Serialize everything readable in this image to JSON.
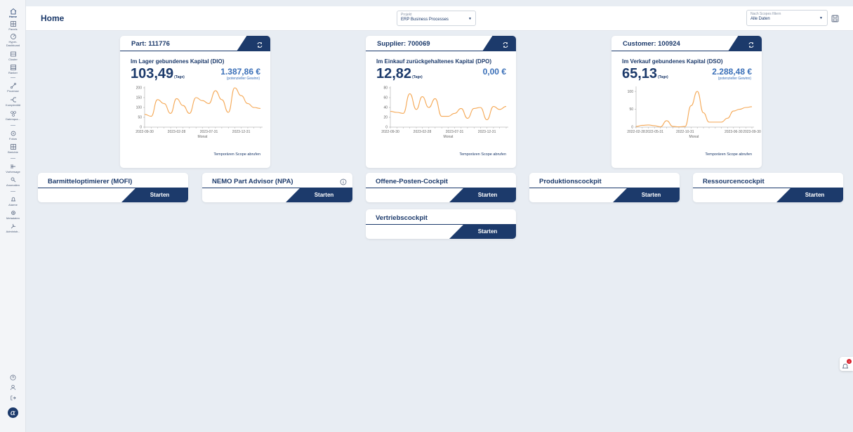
{
  "sidebar": {
    "items": [
      {
        "label": "Home",
        "icon": "home-icon"
      },
      {
        "label": "Panels",
        "icon": "panels-icon"
      },
      {
        "label": "Hyper-",
        "label2": "Dashboard",
        "icon": "hyper-dashboard-icon"
      },
      {
        "label": "Cluster",
        "icon": "cluster-icon"
      },
      {
        "label": "Ranker",
        "icon": "ranker-icon"
      },
      {
        "label": "Prozesse",
        "icon": "prozesse-icon"
      },
      {
        "label": "Komplexität",
        "icon": "komplexitaet-icon"
      },
      {
        "label": "Datenqua...",
        "icon": "datenqualitaet-icon"
      },
      {
        "label": "Fokus",
        "icon": "fokus-icon"
      },
      {
        "label": "Berichte",
        "icon": "berichte-icon"
      },
      {
        "label": "Vorhersage",
        "icon": "vorhersage-icon"
      },
      {
        "label": "Anomalien",
        "icon": "anomalien-icon"
      },
      {
        "label": "Alarme",
        "icon": "alarme-icon"
      },
      {
        "label": "Metadaten",
        "icon": "metadaten-icon"
      },
      {
        "label": "Administr...",
        "icon": "administration-icon"
      }
    ],
    "bottom": [
      "help-icon",
      "user-icon",
      "logout-icon"
    ],
    "logo": "α"
  },
  "header": {
    "title": "Home",
    "project": {
      "label": "Projekt",
      "value": "ERP Business Processes"
    },
    "scope": {
      "label": "Nach Scopes filtern",
      "value": "Alle Daten"
    }
  },
  "kpis": [
    {
      "title": "Part: 111776",
      "subtitle": "Im Lager gebundenes Kapital (DIO)",
      "value": "103,49",
      "unit": "(Tage)",
      "amount": "1.387,86 €",
      "amount_hint": "(potenzieller Gewinn)",
      "link": "Temporären Scope abrufen",
      "color": "#f5a855",
      "chart_data": {
        "type": "line",
        "xlabel": "Monat",
        "x_ticks": [
          "2022-09-30",
          "2023-02-28",
          "2023-07-31",
          "2023-12-31"
        ],
        "y_ticks": [
          0,
          50,
          100,
          150,
          200
        ],
        "ylim": [
          0,
          200
        ],
        "x": [
          "2022-09-30",
          "2022-10-31",
          "2022-11-30",
          "2022-12-31",
          "2023-01-31",
          "2023-02-28",
          "2023-03-31",
          "2023-04-30",
          "2023-05-31",
          "2023-06-30",
          "2023-07-31",
          "2023-08-31",
          "2023-09-30",
          "2023-10-31",
          "2023-11-30",
          "2023-12-31",
          "2024-01-31",
          "2024-02-29",
          "2024-03-31"
        ],
        "values": [
          65,
          55,
          140,
          120,
          70,
          145,
          110,
          70,
          150,
          135,
          120,
          185,
          140,
          75,
          200,
          160,
          120,
          100,
          95
        ]
      }
    },
    {
      "title": "Supplier: 700069",
      "subtitle": "Im Einkauf zurückgehaltenes Kapital (DPO)",
      "value": "12,82",
      "unit": "(Tage)",
      "amount": "0,00 €",
      "amount_hint": "",
      "link": "Temporären Scope abrufen",
      "color": "#f5a855",
      "chart_data": {
        "type": "line",
        "xlabel": "Monat",
        "x_ticks": [
          "2022-09-30",
          "2023-02-28",
          "2023-07-31",
          "2023-12-31"
        ],
        "y_ticks": [
          0,
          20,
          40,
          60,
          80
        ],
        "ylim": [
          0,
          80
        ],
        "x": [
          "2022-09-30",
          "2022-10-31",
          "2022-11-30",
          "2022-12-31",
          "2023-01-31",
          "2023-02-28",
          "2023-03-31",
          "2023-04-30",
          "2023-05-31",
          "2023-06-30",
          "2023-07-31",
          "2023-08-31",
          "2023-09-30",
          "2023-10-31",
          "2023-11-30",
          "2023-12-31",
          "2024-01-31",
          "2024-02-29",
          "2024-03-31"
        ],
        "values": [
          32,
          30,
          28,
          68,
          36,
          62,
          40,
          58,
          22,
          22,
          28,
          38,
          18,
          38,
          40,
          15,
          42,
          36,
          42
        ]
      }
    },
    {
      "title": "Customer: 100924",
      "subtitle": "Im Verkauf gebundenes Kapital (DSO)",
      "value": "65,13",
      "unit": "(Tage)",
      "amount": "2.288,48 €",
      "amount_hint": "(potenzieller Gewinn)",
      "link": "Temporären Scope abrufen",
      "color": "#f5a855",
      "chart_data": {
        "type": "line",
        "xlabel": "Monat",
        "x_ticks": [
          "2022-02-28",
          "2022-05-31",
          "2022-10-31",
          "2023-06-30",
          "2023-09-30"
        ],
        "y_ticks": [
          0,
          50,
          100
        ],
        "ylim": [
          0,
          110
        ],
        "x": [
          "2022-02-28",
          "2022-03-31",
          "2022-04-30",
          "2022-05-31",
          "2022-06-30",
          "2022-07-31",
          "2022-08-31",
          "2022-09-30",
          "2022-10-31",
          "2022-11-30",
          "2022-12-31",
          "2023-01-31",
          "2023-02-28",
          "2023-03-31",
          "2023-04-30",
          "2023-05-31",
          "2023-06-30",
          "2023-07-31",
          "2023-08-31",
          "2023-09-30"
        ],
        "values": [
          2,
          5,
          6,
          4,
          1,
          18,
          2,
          1,
          2,
          60,
          100,
          40,
          14,
          14,
          14,
          25,
          45,
          50,
          55,
          57
        ]
      }
    }
  ],
  "launchers": [
    {
      "title": "Barmitteloptimierer (MOFI)",
      "button": "Starten"
    },
    {
      "title": "NEMO Part Advisor (NPA)",
      "button": "Starten"
    },
    {
      "title": "Offene-Posten-Cockpit",
      "button": "Starten"
    },
    {
      "title": "Produktionscockpit",
      "button": "Starten"
    },
    {
      "title": "Ressourcencockpit",
      "button": "Starten"
    },
    {
      "title": "Vertriebscockpit",
      "button": "Starten"
    }
  ],
  "notifications": {
    "count": "1"
  },
  "colors": {
    "brand": "#1c3a6b",
    "accent": "#3b70b8",
    "line": "#f5a855",
    "badge": "#d9232e"
  }
}
